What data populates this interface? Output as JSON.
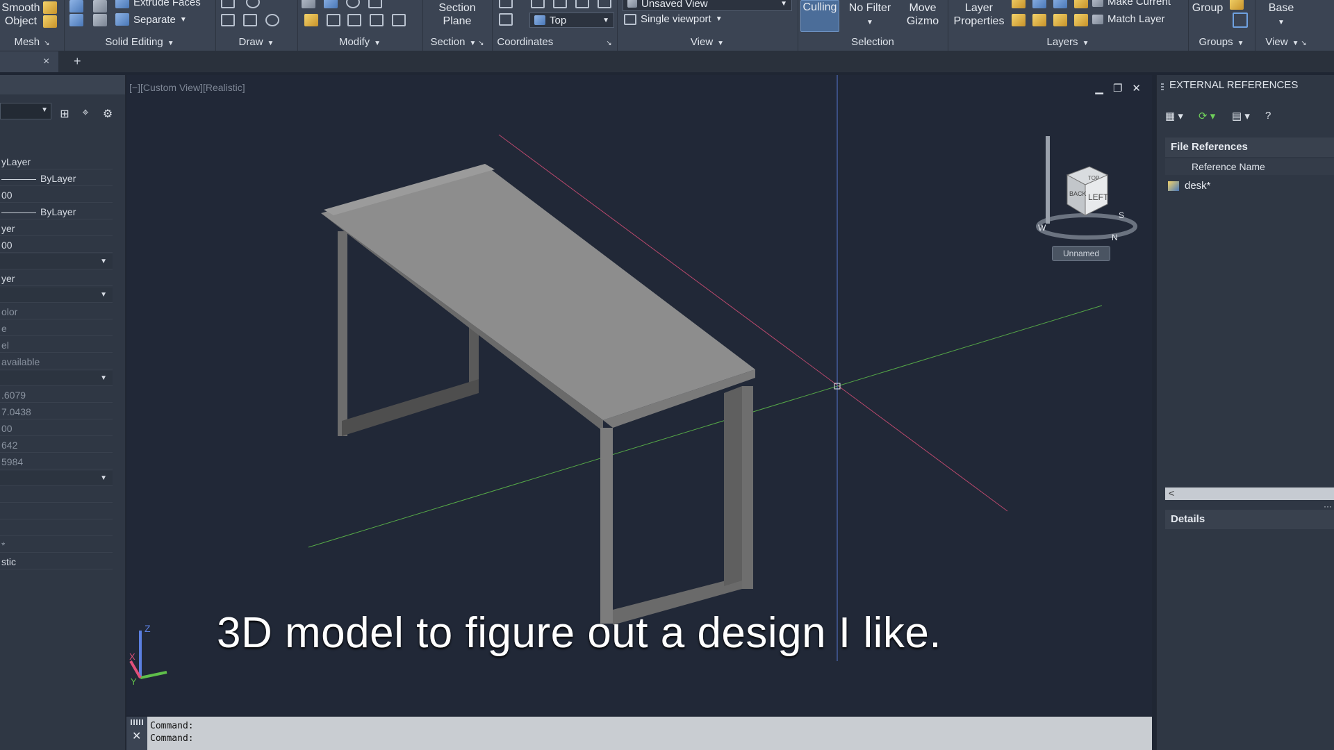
{
  "ribbon": {
    "mesh": {
      "title": "Mesh",
      "smooth_label": "Smooth\nObject"
    },
    "solid_editing": {
      "title": "Solid Editing",
      "extrude_faces": "Extrude Faces",
      "separate": "Separate"
    },
    "draw": {
      "title": "Draw"
    },
    "modify": {
      "title": "Modify"
    },
    "section": {
      "title": "Section",
      "section_plane": "Section\nPlane"
    },
    "coordinates": {
      "title": "Coordinates",
      "top_value": "Top"
    },
    "view": {
      "title": "View",
      "saved_view": "Unsaved View",
      "viewport": "Single viewport"
    },
    "selection": {
      "title": "Selection",
      "culling": "Culling",
      "no_filter": "No Filter",
      "move_gizmo": "Move\nGizmo"
    },
    "layers": {
      "title": "Layers",
      "layer_properties": "Layer\nProperties",
      "make_current": "Make Current",
      "match_layer": "Match Layer"
    },
    "groups": {
      "title": "Groups",
      "group": "Group"
    },
    "view2": {
      "title": "View",
      "base": "Base"
    }
  },
  "tabs": {
    "close": "×",
    "add": "+"
  },
  "properties": {
    "rows": [
      {
        "text": "yLayer",
        "type": "value"
      },
      {
        "text": "ByLayer",
        "type": "linetype"
      },
      {
        "text": "00",
        "type": "value"
      },
      {
        "text": "ByLayer",
        "type": "linetype"
      },
      {
        "text": "yer",
        "type": "value"
      },
      {
        "text": "00",
        "type": "value"
      },
      {
        "text": "",
        "type": "section"
      },
      {
        "text": "yer",
        "type": "value"
      },
      {
        "text": "",
        "type": "section"
      },
      {
        "text": "olor",
        "type": "dim"
      },
      {
        "text": "e",
        "type": "dim"
      },
      {
        "text": "el",
        "type": "dim"
      },
      {
        "text": "available",
        "type": "dim"
      },
      {
        "text": "",
        "type": "section"
      },
      {
        "text": ".6079",
        "type": "dim"
      },
      {
        "text": "7.0438",
        "type": "dim"
      },
      {
        "text": "00",
        "type": "dim"
      },
      {
        "text": "642",
        "type": "dim"
      },
      {
        "text": "5984",
        "type": "dim"
      },
      {
        "text": "",
        "type": "section"
      },
      {
        "text": "",
        "type": "value"
      },
      {
        "text": "",
        "type": "value"
      },
      {
        "text": "",
        "type": "value"
      },
      {
        "text": "*",
        "type": "dim"
      },
      {
        "text": "stic",
        "type": "value"
      }
    ]
  },
  "viewport": {
    "label": "[−][Custom View][Realistic]",
    "minimize": "▁",
    "restore": "❐",
    "close": "✕",
    "viewcube_face": "LEFT",
    "viewcube_face2": "BACK",
    "viewcube_top": "TOP",
    "compass_s": "S",
    "compass_w": "W",
    "compass_n": "N",
    "unnamed": "Unnamed",
    "subtitle": "3D model to figure out a design I like."
  },
  "command": {
    "line1": "Command:",
    "line2": "Command:"
  },
  "xref": {
    "title": "EXTERNAL REFERENCES",
    "file_refs": "File References",
    "col_name": "Reference Name",
    "ref_item": "desk*",
    "details": "Details",
    "scroll_left": "<",
    "dots": "···"
  },
  "colors": {
    "bg": "#212837",
    "x_axis": "#e0507a",
    "y_axis": "#5fbf4a",
    "z_axis": "#5b7fe0"
  }
}
